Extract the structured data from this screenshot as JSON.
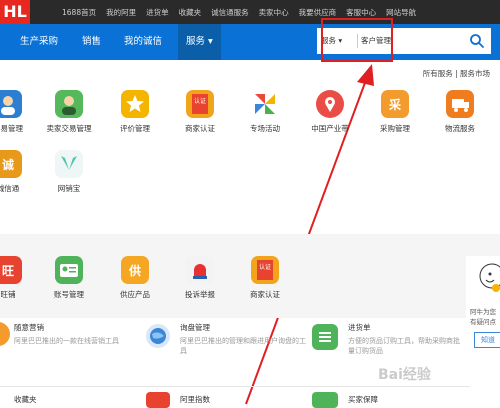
{
  "topbar": {
    "logo": "HL",
    "links": [
      "1688首页",
      "我的阿里",
      "进货单",
      "收藏夹",
      "诚信通服务",
      "卖家中心",
      "我要供应商",
      "客服中心",
      "网站导航"
    ]
  },
  "nav": {
    "items": [
      "生产采购",
      "销售",
      "我的诚信",
      "服务"
    ],
    "active": "服务 ▾"
  },
  "search": {
    "scope": "服务",
    "value": "客户管理"
  },
  "toplinks": "所有服务  |  服务市场",
  "row1": [
    {
      "label": "交易管理",
      "icon": "avatar-icon",
      "color": "#2a7fd4"
    },
    {
      "label": "卖家交易管理",
      "icon": "avatar-icon",
      "color": "#55b85a"
    },
    {
      "label": "评价管理",
      "icon": "star-icon",
      "color": "#f5b400"
    },
    {
      "label": "商家认证",
      "icon": "certification-icon",
      "color": "#f2a51a"
    },
    {
      "label": "专场活动",
      "icon": "pinwheel-icon",
      "color": "#e84a3e"
    },
    {
      "label": "中国产业带",
      "icon": "location-icon",
      "color": "#ea4d46"
    },
    {
      "label": "采购管理",
      "icon": "purchase-icon",
      "color": "#f39b2d"
    },
    {
      "label": "物流服务",
      "icon": "truck-icon",
      "color": "#f07c20"
    }
  ],
  "row2": [
    {
      "label": "诚信通",
      "icon": "chengxin-icon",
      "color": "#e8991a"
    },
    {
      "label": "网销宝",
      "icon": "wing-icon",
      "color": "#4cc5a8"
    }
  ],
  "row3": [
    {
      "label": "旺铺",
      "icon": "shop-icon",
      "color": "#e8432e"
    },
    {
      "label": "账号管理",
      "icon": "id-card-icon",
      "color": "#4fb35a"
    },
    {
      "label": "供应产品",
      "icon": "supply-icon",
      "color": "#f5a623"
    },
    {
      "label": "投诉举报",
      "icon": "alarm-icon",
      "color": "#e83030"
    },
    {
      "label": "商家认证",
      "icon": "certification-icon",
      "color": "#f2a51a"
    }
  ],
  "bottom": [
    {
      "title": "随意营销",
      "desc": "阿里巴巴推出的一款在线营销工具"
    },
    {
      "title": "询盘管理",
      "desc": "阿里巴巴推出的管理和跟进用户询盘的工具"
    },
    {
      "title": "进货单",
      "desc": "方便的货品订购工具，帮助采购商批量订购货品"
    }
  ],
  "bottom2": [
    "收藏夹",
    "阿里指数",
    "买家保障"
  ],
  "side": {
    "text1": "阿牛为您",
    "text2": "有疑问点",
    "button": "知道"
  },
  "watermark": "Bai经验",
  "colors": {
    "nav": "#0a72d7",
    "highlight": "#e02020",
    "arrow": "#e02020"
  }
}
